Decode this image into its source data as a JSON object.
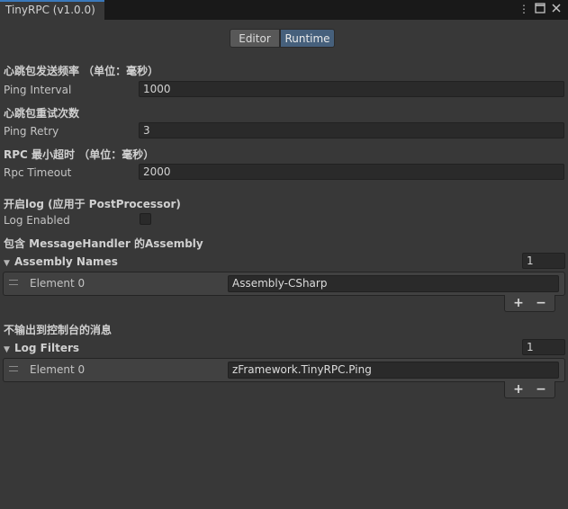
{
  "window": {
    "tab_title": "TinyRPC (v1.0.0)",
    "icons": [
      "more-vert-icon",
      "maximize-icon",
      "close-icon"
    ]
  },
  "toolbar": {
    "modes": [
      "Editor",
      "Runtime"
    ],
    "selected": "Runtime"
  },
  "settings": {
    "ping_interval": {
      "header": "心跳包发送频率 （单位：毫秒）",
      "label": "Ping Interval",
      "value": "1000"
    },
    "ping_retry": {
      "header": "心跳包重试次数",
      "label": "Ping Retry",
      "value": "3"
    },
    "rpc_timeout": {
      "header": "RPC 最小超时 （单位：毫秒）",
      "label": "Rpc Timeout",
      "value": "2000"
    },
    "log_enabled": {
      "header": "开启log (应用于 PostProcessor)",
      "label": "Log Enabled",
      "checked": false
    }
  },
  "assembly_names": {
    "header": "包含 MessageHandler 的Assembly",
    "foldout_label": "Assembly Names",
    "size": "1",
    "elements": [
      {
        "label": "Element 0",
        "value": "Assembly-CSharp"
      }
    ]
  },
  "log_filters": {
    "header": "不输出到控制台的消息",
    "foldout_label": "Log Filters",
    "size": "1",
    "elements": [
      {
        "label": "Element 0",
        "value": "zFramework.TinyRPC.Ping"
      }
    ]
  },
  "list_buttons": {
    "add": "+",
    "remove": "−"
  },
  "colors": {
    "accent": "#3a79bb",
    "selected_mode": "#46607c",
    "background": "#383838"
  }
}
